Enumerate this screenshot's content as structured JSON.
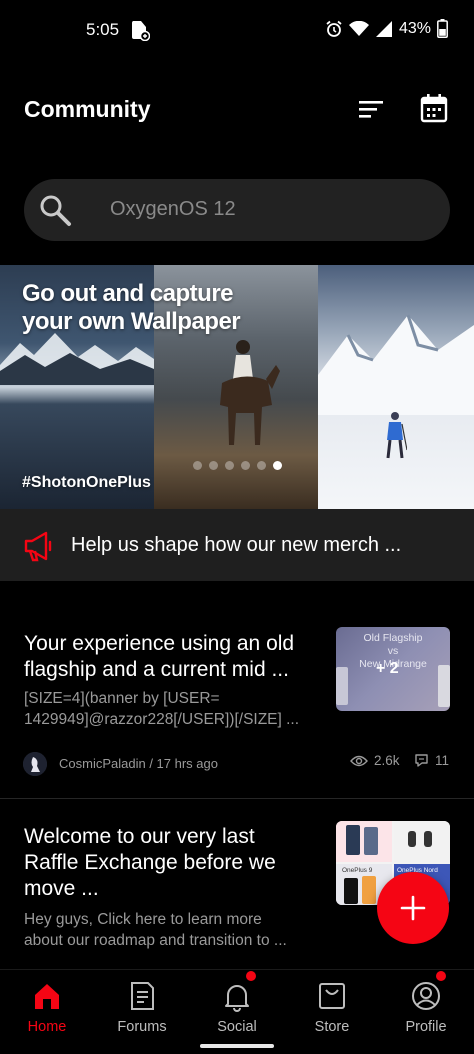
{
  "status_bar": {
    "time": "5:05",
    "battery": "43%"
  },
  "header": {
    "title": "Community"
  },
  "search": {
    "placeholder": "OxygenOS 12"
  },
  "banner": {
    "headline_line1": "Go out and capture",
    "headline_line2": "your own Wallpaper",
    "hashtag": "#ShotonOnePlus",
    "carousel_count": 6,
    "carousel_active_index": 5
  },
  "announcement": {
    "text": "Help us shape how our new merch ..."
  },
  "posts": [
    {
      "title_line1": "Your experience using an old",
      "title_line2": "flagship and a current mid ...",
      "snippet_line1": "[SIZE=4](banner by [USER=",
      "snippet_line2": "1429949]@razzor228[/USER])[/SIZE] ...",
      "thumb_line1": "Old Flagship",
      "thumb_line2": "vs",
      "thumb_line3": "New Midrange",
      "thumb_badge": "+ 2",
      "author": "CosmicPaladin",
      "time": "17 hrs ago",
      "meta": "CosmicPaladin / 17 hrs ago",
      "views": "2.6k",
      "comments": "11"
    },
    {
      "title_line1": "Welcome to our very last",
      "title_line2": "Raffle Exchange before we",
      "title_line3": "move ...",
      "snippet_line1": "Hey guys, Click here to learn more",
      "snippet_line2": "about our roadmap and transition to ...",
      "thumb_label1": "OnePlus 9",
      "thumb_label2": "OnePlus Nord CE 2 Lite"
    }
  ],
  "fab": {
    "icon": "plus-icon"
  },
  "bottom_nav": {
    "items": [
      {
        "label": "Home",
        "icon": "home-icon",
        "active": true
      },
      {
        "label": "Forums",
        "icon": "forums-icon"
      },
      {
        "label": "Social",
        "icon": "bell-icon",
        "badge": true
      },
      {
        "label": "Store",
        "icon": "store-icon"
      },
      {
        "label": "Profile",
        "icon": "profile-icon",
        "badge": true
      }
    ]
  },
  "colors": {
    "accent": "#f50514",
    "background": "#000000",
    "surface": "#222222",
    "muted_text": "#9a9a9a"
  }
}
